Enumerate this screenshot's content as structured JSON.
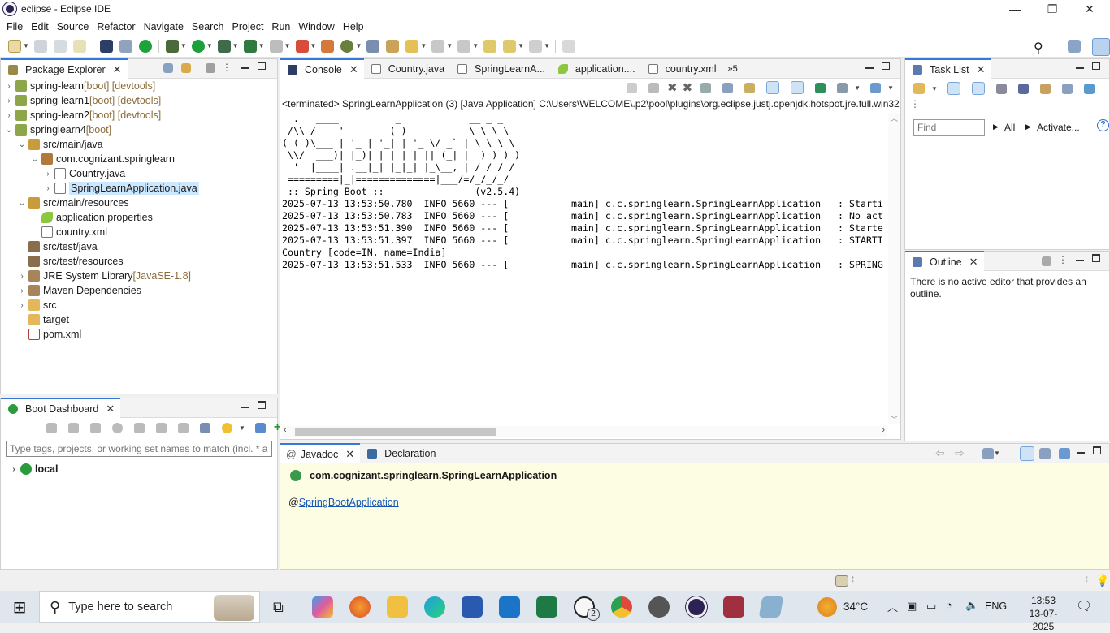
{
  "window": {
    "title": "eclipse - Eclipse IDE",
    "minimize": "—",
    "restore": "❐",
    "close": "✕"
  },
  "menu": [
    "File",
    "Edit",
    "Source",
    "Refactor",
    "Navigate",
    "Search",
    "Project",
    "Run",
    "Window",
    "Help"
  ],
  "package_explorer": {
    "tab": "Package Explorer",
    "items": [
      {
        "label": "spring-learn",
        "decor": " [boot] [devtools]",
        "indent": 0,
        "arrow": "›",
        "icon": "project-icon"
      },
      {
        "label": "spring-learn1",
        "decor": " [boot] [devtools]",
        "indent": 0,
        "arrow": "›",
        "icon": "project-icon"
      },
      {
        "label": "spring-learn2",
        "decor": " [boot] [devtools]",
        "indent": 0,
        "arrow": "›",
        "icon": "project-icon"
      },
      {
        "label": "springlearn4",
        "decor": " [boot]",
        "indent": 0,
        "arrow": "⌄",
        "icon": "project-icon"
      },
      {
        "label": "src/main/java",
        "decor": "",
        "indent": 1,
        "arrow": "⌄",
        "icon": "source-folder-icon"
      },
      {
        "label": "com.cognizant.springlearn",
        "decor": "",
        "indent": 2,
        "arrow": "⌄",
        "icon": "package-icon"
      },
      {
        "label": "Country.java",
        "decor": "",
        "indent": 3,
        "arrow": "›",
        "icon": "java-file-icon"
      },
      {
        "label": "SpringLearnApplication.java",
        "decor": "",
        "indent": 3,
        "arrow": "›",
        "icon": "java-file-icon",
        "selected": true
      },
      {
        "label": "src/main/resources",
        "decor": "",
        "indent": 1,
        "arrow": "⌄",
        "icon": "source-folder-icon"
      },
      {
        "label": "application.properties",
        "decor": "",
        "indent": 2,
        "arrow": "",
        "icon": "properties-file-icon"
      },
      {
        "label": "country.xml",
        "decor": "",
        "indent": 2,
        "arrow": "",
        "icon": "xml-file-icon"
      },
      {
        "label": "src/test/java",
        "decor": "",
        "indent": 1,
        "arrow": "",
        "icon": "source-folder-icon"
      },
      {
        "label": "src/test/resources",
        "decor": "",
        "indent": 1,
        "arrow": "",
        "icon": "source-folder-icon"
      },
      {
        "label": "JRE System Library",
        "decor": " [JavaSE-1.8]",
        "indent": 1,
        "arrow": "›",
        "icon": "library-icon"
      },
      {
        "label": "Maven Dependencies",
        "decor": "",
        "indent": 1,
        "arrow": "›",
        "icon": "library-icon"
      },
      {
        "label": "src",
        "decor": "",
        "indent": 1,
        "arrow": "›",
        "icon": "folder-icon"
      },
      {
        "label": "target",
        "decor": "",
        "indent": 1,
        "arrow": "",
        "icon": "folder-icon"
      },
      {
        "label": "pom.xml",
        "decor": "",
        "indent": 1,
        "arrow": "",
        "icon": "maven-xml-icon"
      }
    ]
  },
  "boot_dashboard": {
    "tab": "Boot Dashboard",
    "filter_placeholder": "Type tags, projects, or working set names to match (incl. * an",
    "local": "local"
  },
  "editor_tabs": [
    {
      "label": "Console",
      "active": true
    },
    {
      "label": "Country.java",
      "active": false
    },
    {
      "label": "SpringLearnA...",
      "active": false
    },
    {
      "label": "application....",
      "active": false
    },
    {
      "label": "country.xml",
      "active": false
    },
    {
      "label": "»5",
      "active": false
    }
  ],
  "console": {
    "header": "<terminated> SpringLearnApplication (3) [Java Application] C:\\Users\\WELCOME\\.p2\\pool\\plugins\\org.eclipse.justj.openjdk.hotspot.jre.full.win32",
    "lines": [
      "",
      "  .   ____          _            __ _ _",
      " /\\\\ / ___'_ __ _ _(_)_ __  __ _ \\ \\ \\ \\",
      "( ( )\\___ | '_ | '_| | '_ \\/ _` | \\ \\ \\ \\",
      " \\\\/  ___)| |_)| | | | | || (_| |  ) ) ) )",
      "  '  |____| .__|_| |_|_| |_\\__, | / / / /",
      " =========|_|==============|___/=/_/_/_/",
      " :: Spring Boot ::                (v2.5.4)",
      "",
      "2025-07-13 13:53:50.780  INFO 5660 --- [           main] c.c.springlearn.SpringLearnApplication   : Starti",
      "2025-07-13 13:53:50.783  INFO 5660 --- [           main] c.c.springlearn.SpringLearnApplication   : No act",
      "2025-07-13 13:53:51.390  INFO 5660 --- [           main] c.c.springlearn.SpringLearnApplication   : Starte",
      "2025-07-13 13:53:51.397  INFO 5660 --- [           main] c.c.springlearn.SpringLearnApplication   : STARTI",
      "Country [code=IN, name=India]",
      "2025-07-13 13:53:51.533  INFO 5660 --- [           main] c.c.springlearn.SpringLearnApplication   : SPRING"
    ]
  },
  "task_list": {
    "tab": "Task List",
    "find_placeholder": "Find",
    "all": "All",
    "activate": "Activate..."
  },
  "outline": {
    "tab": "Outline",
    "message": "There is no active editor that provides an outline."
  },
  "javadoc": {
    "tabs": [
      "Javadoc",
      "Declaration"
    ],
    "class_name": "com.cognizant.springlearn.SpringLearnApplication",
    "annotation_prefix": "@",
    "annotation_link": "SpringBootApplication"
  },
  "taskbar": {
    "search_placeholder": "Type here to search",
    "weather": "34°C",
    "language": "ENG",
    "time": "13:53",
    "date": "13-07-2025",
    "whatsapp_badge": "2"
  },
  "colors": {
    "accent": "#3478d8",
    "javadoc_bg": "#fdfde4",
    "selection": "#cce8ff",
    "taskbar": "#dfe6ee"
  }
}
